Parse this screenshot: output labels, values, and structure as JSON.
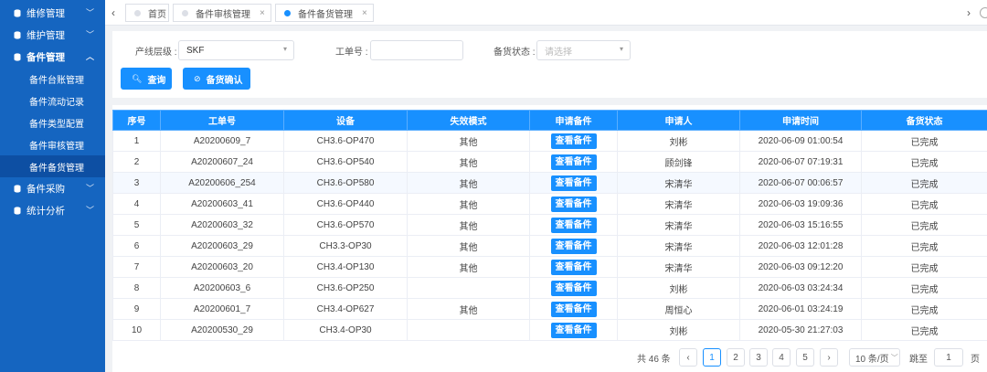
{
  "sidebar": {
    "groups_top": [
      {
        "label": "维修管理",
        "chevron": "﹀"
      },
      {
        "label": "维护管理",
        "chevron": "﹀"
      }
    ],
    "active_group": {
      "label": "备件管理",
      "chevron": "︿"
    },
    "sub_items": [
      {
        "label": "备件台账管理"
      },
      {
        "label": "备件流动记录"
      },
      {
        "label": "备件类型配置"
      },
      {
        "label": "备件审核管理"
      },
      {
        "label": "备件备货管理"
      }
    ],
    "groups_bottom": [
      {
        "label": "备件采购",
        "chevron": "﹀"
      },
      {
        "label": "统计分析",
        "chevron": "﹀"
      }
    ]
  },
  "tabs": [
    {
      "label": "首页"
    },
    {
      "label": "备件审核管理",
      "close": "×"
    },
    {
      "label": "备件备货管理",
      "close": "×"
    }
  ],
  "nav": {
    "left": "‹",
    "right": "›"
  },
  "filters": {
    "line_label": "产线层级 :",
    "line_value": "SKF",
    "order_label": "工单号 :",
    "order_value": "",
    "status_label": "备货状态 :",
    "status_placeholder": "请选择"
  },
  "buttons": {
    "query": "查询",
    "confirm": "备货确认"
  },
  "table": {
    "headers": [
      "序号",
      "工单号",
      "设备",
      "失效模式",
      "申请备件",
      "申请人",
      "申请时间",
      "备货状态"
    ],
    "view_label": "查看备件",
    "rows": [
      {
        "no": "1",
        "order": "A20200609_7",
        "device": "CH3.6-OP470",
        "mode": "其他",
        "person": "刘彬",
        "time": "2020-06-09 01:00:54",
        "status": "已完成"
      },
      {
        "no": "2",
        "order": "A20200607_24",
        "device": "CH3.6-OP540",
        "mode": "其他",
        "person": "顾剑锋",
        "time": "2020-06-07 07:19:31",
        "status": "已完成"
      },
      {
        "no": "3",
        "order": "A20200606_254",
        "device": "CH3.6-OP580",
        "mode": "其他",
        "person": "宋清华",
        "time": "2020-06-07 00:06:57",
        "status": "已完成"
      },
      {
        "no": "4",
        "order": "A20200603_41",
        "device": "CH3.6-OP440",
        "mode": "其他",
        "person": "宋清华",
        "time": "2020-06-03 19:09:36",
        "status": "已完成"
      },
      {
        "no": "5",
        "order": "A20200603_32",
        "device": "CH3.6-OP570",
        "mode": "其他",
        "person": "宋清华",
        "time": "2020-06-03 15:16:55",
        "status": "已完成"
      },
      {
        "no": "6",
        "order": "A20200603_29",
        "device": "CH3.3-OP30",
        "mode": "其他",
        "person": "宋清华",
        "time": "2020-06-03 12:01:28",
        "status": "已完成"
      },
      {
        "no": "7",
        "order": "A20200603_20",
        "device": "CH3.4-OP130",
        "mode": "其他",
        "person": "宋清华",
        "time": "2020-06-03 09:12:20",
        "status": "已完成"
      },
      {
        "no": "8",
        "order": "A20200603_6",
        "device": "CH3.6-OP250",
        "mode": "",
        "person": "刘彬",
        "time": "2020-06-03 03:24:34",
        "status": "已完成"
      },
      {
        "no": "9",
        "order": "A20200601_7",
        "device": "CH3.4-OP627",
        "mode": "其他",
        "person": "周恒心",
        "time": "2020-06-01 03:24:19",
        "status": "已完成"
      },
      {
        "no": "10",
        "order": "A20200530_29",
        "device": "CH3.4-OP30",
        "mode": "",
        "person": "刘彬",
        "time": "2020-05-30 21:27:03",
        "status": "已完成"
      }
    ]
  },
  "pagination": {
    "total": "共 46 条",
    "prev": "‹",
    "pages": [
      "1",
      "2",
      "3",
      "4",
      "5"
    ],
    "current": "1",
    "next": "›",
    "size": "10 条/页",
    "size_arrow": "﹀",
    "goto_label": "跳至",
    "goto_value": "1",
    "page_unit": "页"
  },
  "colors": {
    "sidebar": "#1565c0",
    "accent": "#1890ff"
  }
}
